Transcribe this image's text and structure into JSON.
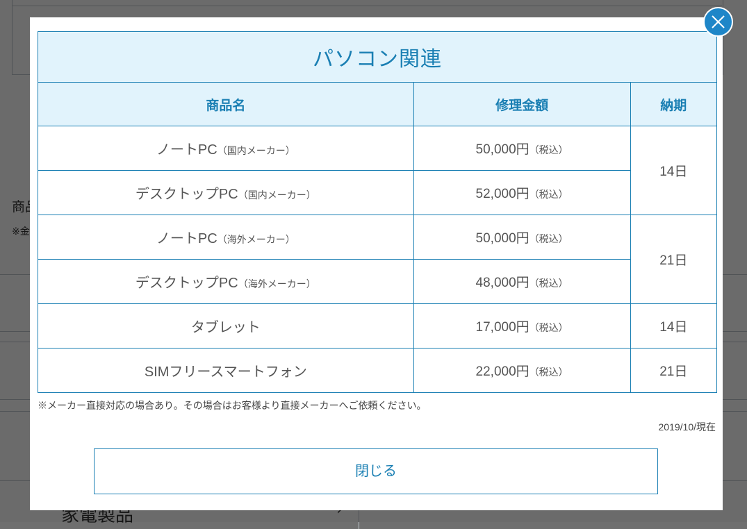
{
  "background": {
    "text_fragment_left": "商品",
    "note_fragment_left": "※金",
    "bottom_heading": "家電製品"
  },
  "modal": {
    "title": "パソコン関連",
    "columns": [
      "商品名",
      "修理金額",
      "納期"
    ],
    "rows": [
      {
        "name": "ノートPC",
        "name_note": "（国内メーカー）",
        "price": "50,000円",
        "tax": "（税込）"
      },
      {
        "name": "デスクトップPC",
        "name_note": "（国内メーカー）",
        "price": "52,000円",
        "tax": "（税込）"
      },
      {
        "name": "ノートPC",
        "name_note": "（海外メーカー）",
        "price": "50,000円",
        "tax": "（税込）"
      },
      {
        "name": "デスクトップPC",
        "name_note": "（海外メーカー）",
        "price": "48,000円",
        "tax": "（税込）"
      },
      {
        "name": "タブレット",
        "name_note": "",
        "price": "17,000円",
        "tax": "（税込）"
      },
      {
        "name": "SIMフリースマートフォン",
        "name_note": "",
        "price": "22,000円",
        "tax": "（税込）"
      }
    ],
    "delivery": [
      "14日",
      "21日",
      "14日",
      "21日"
    ],
    "note": "※メーカー直接対応の場合あり。その場合はお客様より直接メーカーへご依頼ください。",
    "as_of": "2019/10/現在",
    "close_label": "閉じる"
  },
  "icons": {
    "close": "close-icon"
  },
  "colors": {
    "accent": "#1a7fb3",
    "header_bg": "#e1f3fc",
    "close_circle": "#1e86c8"
  }
}
